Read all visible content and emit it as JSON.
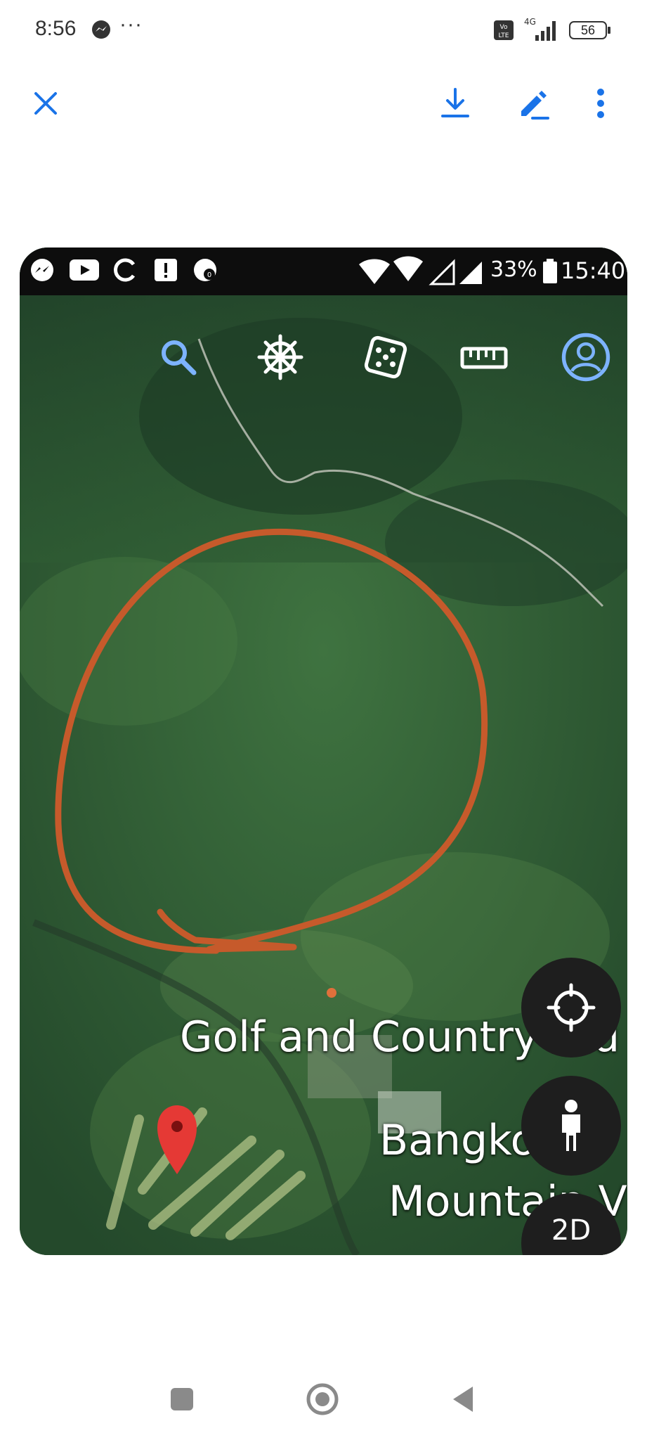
{
  "status_bar": {
    "time": "8:56",
    "overflow": "···",
    "network": "4G",
    "battery": "56",
    "icons": [
      "messenger-icon",
      "volte-icon",
      "signal-icon",
      "battery-icon"
    ]
  },
  "viewer": {
    "actions": [
      "close-icon",
      "download-icon",
      "edit-icon",
      "more-vert-icon"
    ],
    "accent_color": "#1a73e8"
  },
  "screenshot": {
    "inner_status": {
      "battery_pct": "33%",
      "time": "15:40"
    },
    "map_tools": [
      "search-icon",
      "voyager-wheel-icon",
      "dice-icon",
      "ruler-icon",
      "profile-icon"
    ],
    "labels": {
      "golf": "Golf and Country Clu",
      "bangko": "Bangko",
      "mountain": "Mountain Vi"
    },
    "annotation_color": "#c65a2b",
    "pin_color": "#e53935",
    "buttons": {
      "view_mode": "2D"
    }
  },
  "nav_bar": {
    "buttons": [
      "recents-icon",
      "home-icon",
      "back-icon"
    ]
  }
}
